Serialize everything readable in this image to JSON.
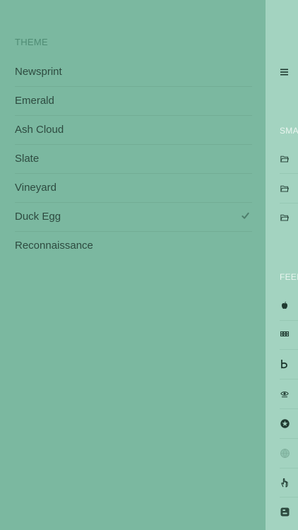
{
  "theme_menu": {
    "header": "THEME",
    "items": [
      {
        "label": "Newsprint",
        "selected": false
      },
      {
        "label": "Emerald",
        "selected": false
      },
      {
        "label": "Ash Cloud",
        "selected": false
      },
      {
        "label": "Slate",
        "selected": false
      },
      {
        "label": "Vineyard",
        "selected": false
      },
      {
        "label": "Duck Egg",
        "selected": true
      },
      {
        "label": "Reconnaissance",
        "selected": false
      }
    ]
  },
  "side_panel": {
    "menu_icon": "hamburger-menu-icon",
    "smart_header": "SMA",
    "smart_icons": [
      "folder-icon",
      "folder-icon",
      "folder-icon"
    ],
    "feeds_header": "FEED",
    "feed_icons": [
      "apple-icon",
      "bbc-icon",
      "b-logo-icon",
      "eye-logo-icon",
      "star-badge-icon",
      "globe-icon",
      "hand-icon",
      "blogger-icon"
    ]
  },
  "colors": {
    "menu_background": "#7bb8a0",
    "strip_background": "#a3d3c0",
    "text": "#2d4a3f"
  }
}
